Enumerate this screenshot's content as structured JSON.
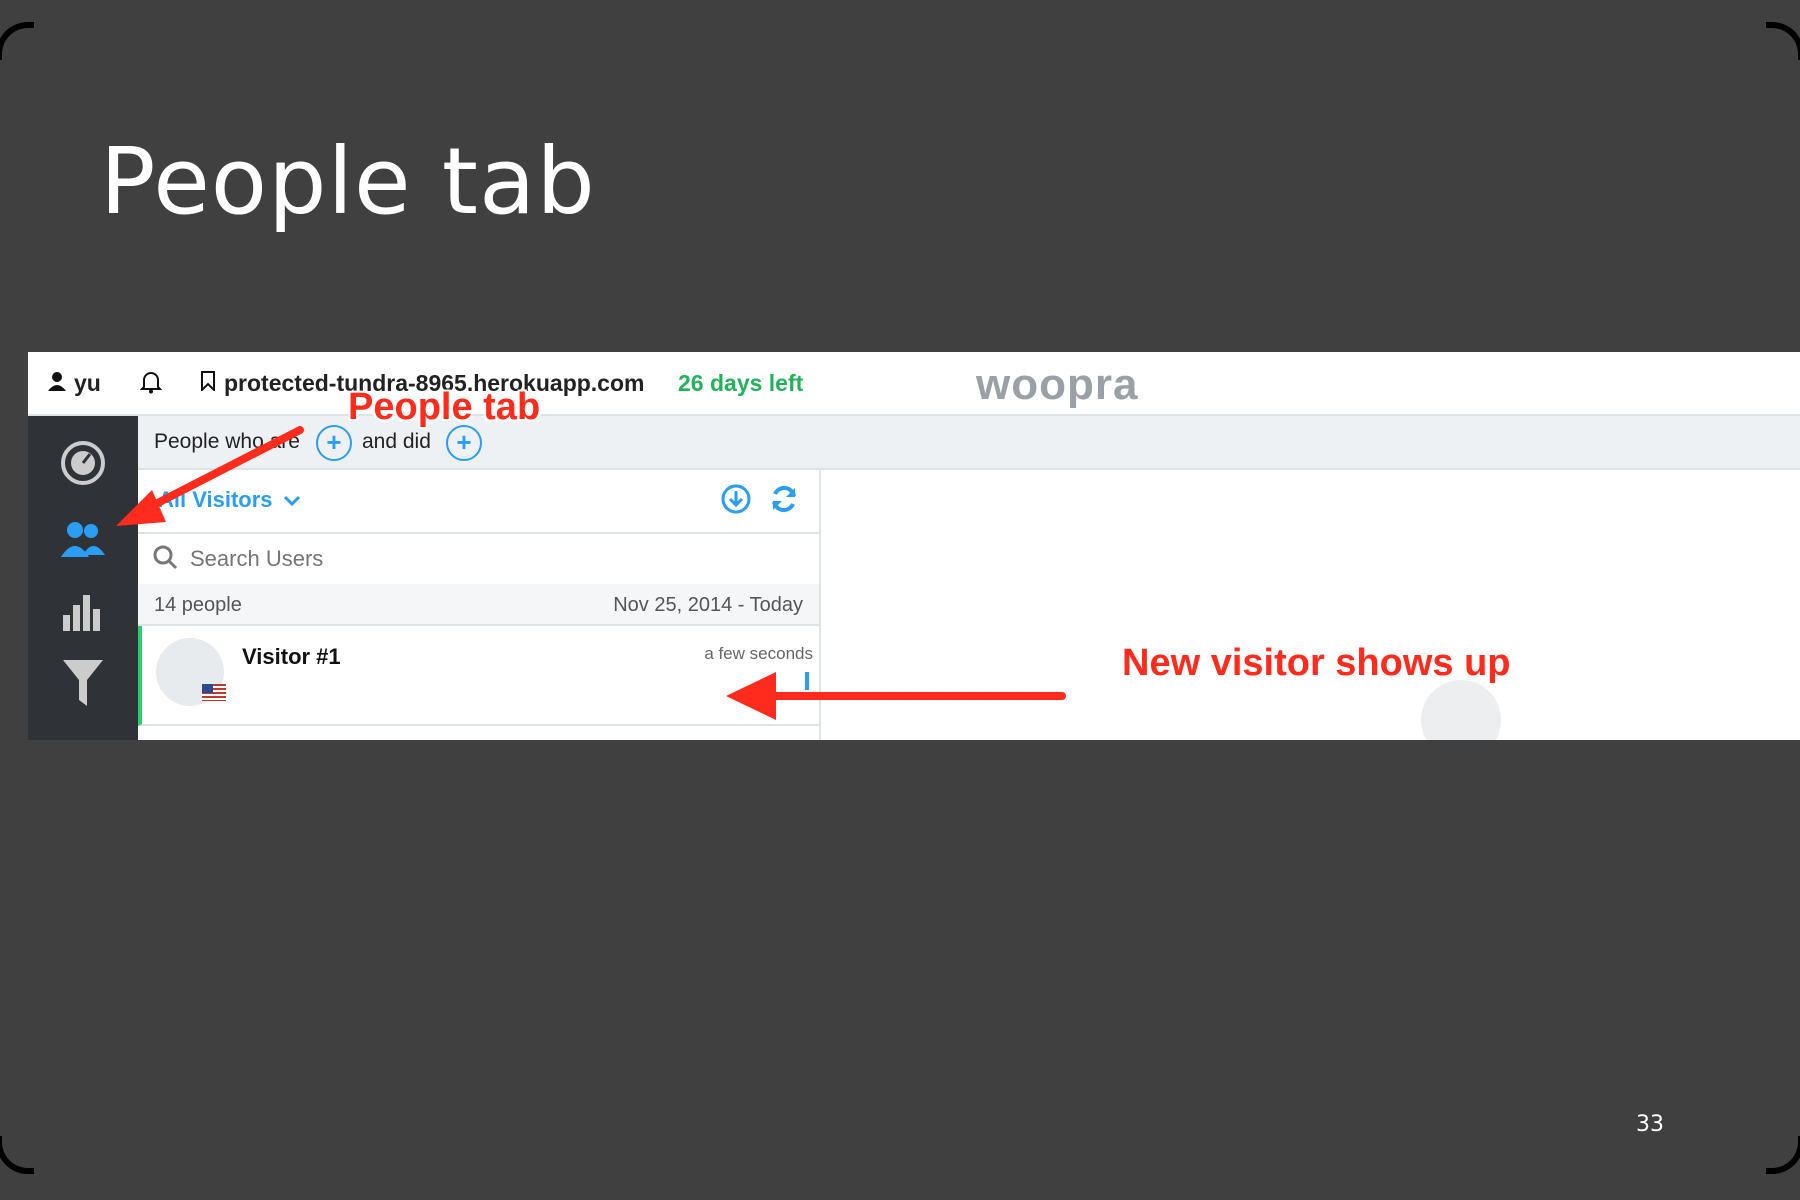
{
  "slide": {
    "title": "People tab",
    "page_number": "33"
  },
  "topbar": {
    "user": "yu",
    "site": "protected-tundra-8965.herokuapp.com",
    "trial": "26 days left",
    "logo": "woopra"
  },
  "filter": {
    "prefix": "People who are",
    "conjunction": "and did"
  },
  "list": {
    "segment": "All Visitors",
    "search_placeholder": "Search Users",
    "count": "14 people",
    "date_range": "Nov 25, 2014 - Today",
    "visitors": [
      {
        "name": "Visitor #1",
        "time": "a few seconds"
      }
    ]
  },
  "annotations": {
    "people_tab": "People tab",
    "new_visitor": "New visitor shows up"
  },
  "colors": {
    "accent": "#2a9df4",
    "trial": "#22b35a",
    "annotation": "#ff2b1c",
    "sidebar": "#2f3338"
  }
}
